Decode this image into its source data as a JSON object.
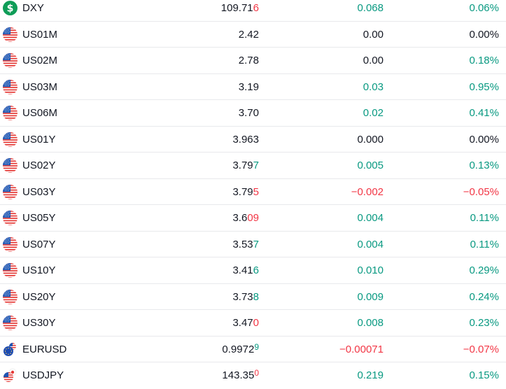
{
  "colors": {
    "up": "#089981",
    "down": "#f23645",
    "neutral": "#131722",
    "separator": "#e8e9ec",
    "dollar_icon": "#0f9d58"
  },
  "rows": [
    {
      "symbol": "DXY",
      "icon": "dollar-icon",
      "last_main": "109.71",
      "last_tail": "6",
      "tail_dir": "down",
      "tail_sup": false,
      "change": "0.068",
      "change_dir": "pos",
      "change_pct": "0.06%",
      "pct_dir": "pos"
    },
    {
      "symbol": "US01M",
      "icon": "us-flag-icon",
      "last_main": "2.42",
      "last_tail": "",
      "tail_dir": "",
      "tail_sup": false,
      "change": "0.00",
      "change_dir": "neu",
      "change_pct": "0.00%",
      "pct_dir": "neu"
    },
    {
      "symbol": "US02M",
      "icon": "us-flag-icon",
      "last_main": "2.78",
      "last_tail": "",
      "tail_dir": "",
      "tail_sup": false,
      "change": "0.00",
      "change_dir": "neu",
      "change_pct": "0.18%",
      "pct_dir": "pos"
    },
    {
      "symbol": "US03M",
      "icon": "us-flag-icon",
      "last_main": "3.19",
      "last_tail": "",
      "tail_dir": "",
      "tail_sup": false,
      "change": "0.03",
      "change_dir": "pos",
      "change_pct": "0.95%",
      "pct_dir": "pos"
    },
    {
      "symbol": "US06M",
      "icon": "us-flag-icon",
      "last_main": "3.70",
      "last_tail": "",
      "tail_dir": "",
      "tail_sup": false,
      "change": "0.02",
      "change_dir": "pos",
      "change_pct": "0.41%",
      "pct_dir": "pos"
    },
    {
      "symbol": "US01Y",
      "icon": "us-flag-icon",
      "last_main": "3.963",
      "last_tail": "",
      "tail_dir": "",
      "tail_sup": false,
      "change": "0.000",
      "change_dir": "neu",
      "change_pct": "0.00%",
      "pct_dir": "neu"
    },
    {
      "symbol": "US02Y",
      "icon": "us-flag-icon",
      "last_main": "3.79",
      "last_tail": "7",
      "tail_dir": "up",
      "tail_sup": false,
      "change": "0.005",
      "change_dir": "pos",
      "change_pct": "0.13%",
      "pct_dir": "pos"
    },
    {
      "symbol": "US03Y",
      "icon": "us-flag-icon",
      "last_main": "3.79",
      "last_tail": "5",
      "tail_dir": "down",
      "tail_sup": false,
      "change": "−0.002",
      "change_dir": "neg",
      "change_pct": "−0.05%",
      "pct_dir": "neg"
    },
    {
      "symbol": "US05Y",
      "icon": "us-flag-icon",
      "last_main": "3.6",
      "last_tail": "09",
      "tail_dir": "down",
      "tail_sup": false,
      "change": "0.004",
      "change_dir": "pos",
      "change_pct": "0.11%",
      "pct_dir": "pos"
    },
    {
      "symbol": "US07Y",
      "icon": "us-flag-icon",
      "last_main": "3.53",
      "last_tail": "7",
      "tail_dir": "up",
      "tail_sup": false,
      "change": "0.004",
      "change_dir": "pos",
      "change_pct": "0.11%",
      "pct_dir": "pos"
    },
    {
      "symbol": "US10Y",
      "icon": "us-flag-icon",
      "last_main": "3.41",
      "last_tail": "6",
      "tail_dir": "up",
      "tail_sup": false,
      "change": "0.010",
      "change_dir": "pos",
      "change_pct": "0.29%",
      "pct_dir": "pos"
    },
    {
      "symbol": "US20Y",
      "icon": "us-flag-icon",
      "last_main": "3.73",
      "last_tail": "8",
      "tail_dir": "up",
      "tail_sup": false,
      "change": "0.009",
      "change_dir": "pos",
      "change_pct": "0.24%",
      "pct_dir": "pos"
    },
    {
      "symbol": "US30Y",
      "icon": "us-flag-icon",
      "last_main": "3.47",
      "last_tail": "0",
      "tail_dir": "down",
      "tail_sup": false,
      "change": "0.008",
      "change_dir": "pos",
      "change_pct": "0.23%",
      "pct_dir": "pos"
    },
    {
      "symbol": "EURUSD",
      "icon": "eu-us-flags-icon",
      "last_main": "0.9972",
      "last_tail": "9",
      "tail_dir": "up",
      "tail_sup": true,
      "change": "−0.00071",
      "change_dir": "neg",
      "change_pct": "−0.07%",
      "pct_dir": "neg"
    },
    {
      "symbol": "USDJPY",
      "icon": "us-jp-flags-icon",
      "last_main": "143.35",
      "last_tail": "0",
      "tail_dir": "down",
      "tail_sup": true,
      "change": "0.219",
      "change_dir": "pos",
      "change_pct": "0.15%",
      "pct_dir": "pos"
    }
  ]
}
